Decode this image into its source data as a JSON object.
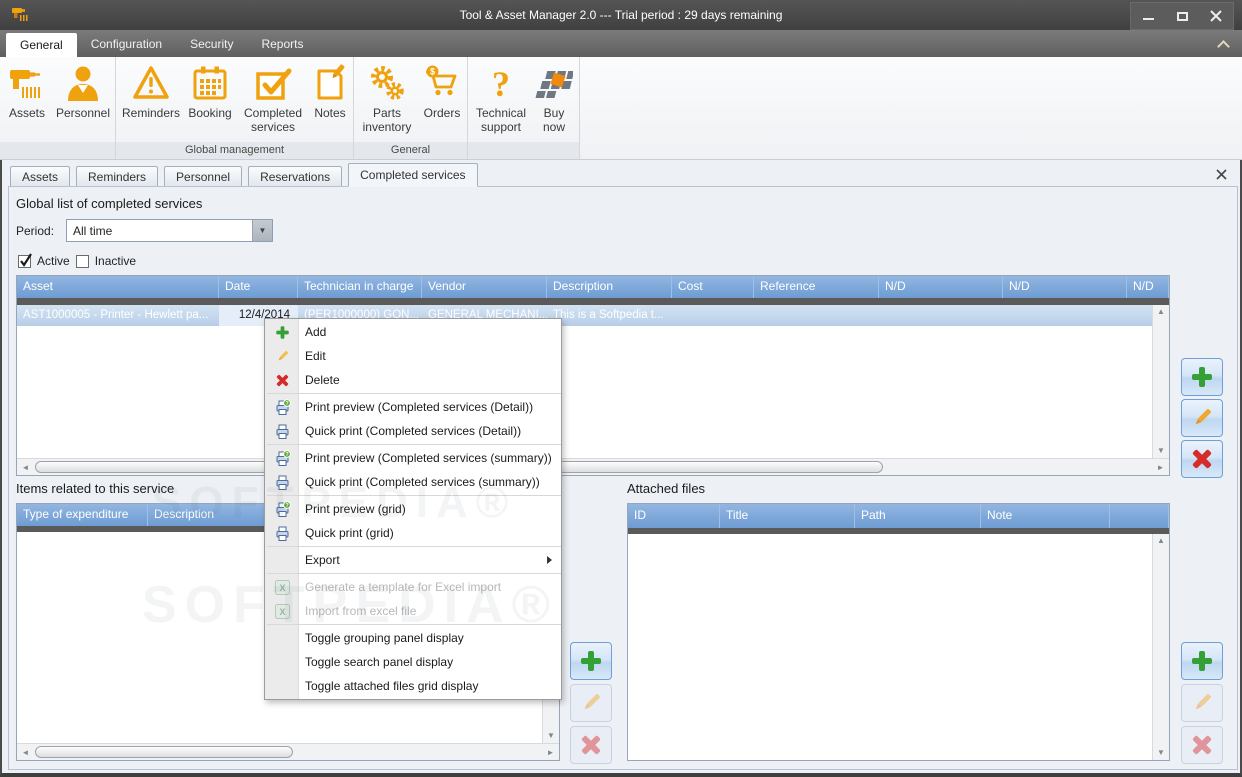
{
  "window": {
    "title": "Tool & Asset Manager 2.0 --- Trial period : 29 days remaining"
  },
  "ribbon": {
    "tabs": [
      "General",
      "Configuration",
      "Security",
      "Reports"
    ],
    "groups": [
      {
        "label": "",
        "items": [
          "Assets",
          "Personnel"
        ]
      },
      {
        "label": "Global management",
        "items": [
          "Reminders",
          "Booking",
          "Completed services",
          "Notes"
        ]
      },
      {
        "label": "General",
        "items": [
          "Parts inventory",
          "Orders"
        ]
      },
      {
        "label": "",
        "items": [
          "Technical support",
          "Buy now"
        ]
      }
    ]
  },
  "doc_tabs": [
    "Assets",
    "Reminders",
    "Personnel",
    "Reservations",
    "Completed services"
  ],
  "main": {
    "section_title": "Global list of completed services",
    "period_label": "Period:",
    "period_value": "All time",
    "active_label": "Active",
    "inactive_label": "Inactive",
    "grid_columns": [
      "Asset",
      "Date",
      "Technician in charge",
      "Vendor",
      "Description",
      "Cost",
      "Reference",
      "N/D",
      "N/D",
      "N/D"
    ],
    "row": {
      "asset": "AST1000005 - Printer - Hewlett pa...",
      "date": "12/4/2014",
      "technician": "(PER1000000) GON...",
      "vendor": "GENERAL MECHANI...",
      "description": "This is a Softpedia t..."
    }
  },
  "related": {
    "title": "Items related to this service",
    "columns": [
      "Type of expenditure",
      "Description"
    ]
  },
  "attached": {
    "title": "Attached files",
    "columns": [
      "ID",
      "Title",
      "Path",
      "Note"
    ]
  },
  "context_menu": {
    "items": [
      {
        "label": "Add"
      },
      {
        "label": "Edit"
      },
      {
        "label": "Delete"
      },
      {
        "label": "Print preview (Completed services (Detail))"
      },
      {
        "label": "Quick print (Completed services (Detail))"
      },
      {
        "label": "Print preview (Completed services (summary))"
      },
      {
        "label": "Quick print (Completed services (summary))"
      },
      {
        "label": "Print preview (grid)"
      },
      {
        "label": "Quick print (grid)"
      },
      {
        "label": "Export"
      },
      {
        "label": "Generate a template for Excel import"
      },
      {
        "label": "Import from excel file"
      },
      {
        "label": "Toggle grouping panel display"
      },
      {
        "label": "Toggle search panel display"
      },
      {
        "label": "Toggle attached files grid display"
      }
    ]
  },
  "watermark": "SOFTPEDIA®",
  "colors": {
    "accent_orange": "#F0A10E",
    "header_blue": "#6E9CD3",
    "add_green": "#35A035",
    "delete_red": "#D62B2B",
    "edit_yellow": "#F0A92C"
  }
}
